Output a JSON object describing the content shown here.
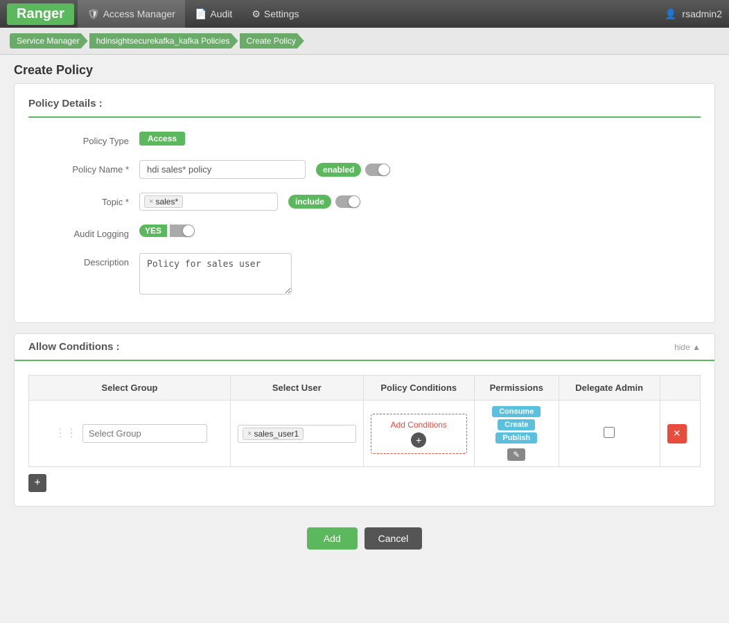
{
  "nav": {
    "brand": "Ranger",
    "items": [
      {
        "label": "Access Manager",
        "icon": "shield"
      },
      {
        "label": "Audit",
        "icon": "doc"
      },
      {
        "label": "Settings",
        "icon": "gear"
      }
    ],
    "user": "rsadmin2"
  },
  "breadcrumb": {
    "items": [
      {
        "label": "Service Manager"
      },
      {
        "label": "hdinsightsecurekafka_kafka Policies"
      },
      {
        "label": "Create Policy"
      }
    ]
  },
  "page_title": "Create Policy",
  "policy_details": {
    "section_title": "Policy Details :",
    "policy_type_label": "Policy Type",
    "policy_type_badge": "Access",
    "policy_name_label": "Policy Name *",
    "policy_name_value": "hdi sales* policy",
    "policy_enabled_label": "enabled",
    "topic_label": "Topic *",
    "topic_tag": "sales*",
    "topic_include_label": "include",
    "audit_logging_label": "Audit Logging",
    "audit_yes_label": "YES",
    "description_label": "Description",
    "description_value": "Policy for sales user"
  },
  "allow_conditions": {
    "section_title": "Allow Conditions :",
    "hide_label": "hide ▲",
    "table": {
      "headers": [
        "Select Group",
        "Select User",
        "Policy Conditions",
        "Permissions",
        "Delegate Admin"
      ],
      "row": {
        "group_placeholder": "Select Group",
        "user_tag": "sales_user1",
        "add_conditions_label": "Add Conditions",
        "permissions": [
          "Consume",
          "Create",
          "Publish"
        ],
        "edit_btn": "✎",
        "plus_btn": "+"
      }
    },
    "add_row_btn": "+"
  },
  "actions": {
    "add_label": "Add",
    "cancel_label": "Cancel"
  }
}
